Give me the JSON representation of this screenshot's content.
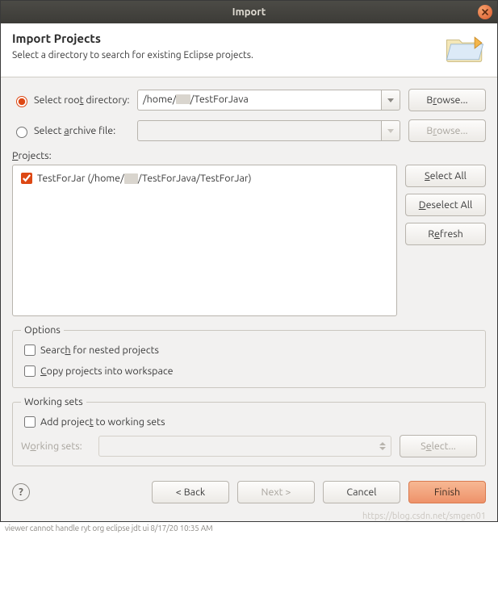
{
  "window": {
    "title": "Import"
  },
  "banner": {
    "heading": "Import Projects",
    "subheading": "Select a directory to search for existing Eclipse projects."
  },
  "source": {
    "root_label": "Select root directory:",
    "root_path": "/home/▮▮▮/TestForJava",
    "root_browse": "Browse...",
    "archive_label": "Select archive file:",
    "archive_path": "",
    "archive_browse": "Browse..."
  },
  "projects": {
    "label": "Projects:",
    "items": [
      {
        "checked": true,
        "label": "TestForJar (/home/▮▮▮/TestForJava/TestForJar)"
      }
    ],
    "select_all": "Select All",
    "deselect_all": "Deselect All",
    "refresh": "Refresh"
  },
  "options": {
    "legend": "Options",
    "nested_label": "Search for nested projects",
    "copy_label": "Copy projects into workspace"
  },
  "working_sets": {
    "legend": "Working sets",
    "add_label": "Add project to working sets",
    "list_label": "Working sets:",
    "select_btn": "Select..."
  },
  "footer": {
    "back": "< Back",
    "next": "Next >",
    "cancel": "Cancel",
    "finish": "Finish"
  },
  "underflow_text": "viewer cannot handle ryt org eclipse jdt ui      8/17/20  10:35 AM",
  "watermark": "https://blog.csdn.net/smgen01"
}
